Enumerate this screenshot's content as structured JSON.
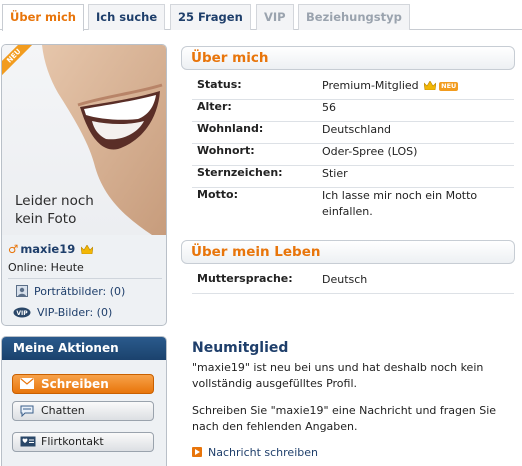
{
  "tabs": [
    {
      "label": "Über mich",
      "state": "active"
    },
    {
      "label": "Ich suche",
      "state": "normal"
    },
    {
      "label": "25 Fragen",
      "state": "normal"
    },
    {
      "label": "VIP",
      "state": "disabled"
    },
    {
      "label": "Beziehungstyp",
      "state": "disabled"
    }
  ],
  "profile": {
    "ribbon": "NEU",
    "no_photo_text_line1": "Leider noch",
    "no_photo_text_line2": "kein Foto",
    "gender_symbol": "♂",
    "username": "maxie19",
    "online": "Online: Heute",
    "links": [
      {
        "label": "Porträtbilder: (0)",
        "icon": "portrait-icon"
      },
      {
        "label": "VIP-Bilder: (0)",
        "icon": "vip-icon"
      }
    ]
  },
  "actions": {
    "title": "Meine Aktionen",
    "buttons": [
      {
        "label": "Schreiben",
        "icon": "envelope-icon"
      },
      {
        "label": "Chatten",
        "icon": "chat-bubble-icon"
      },
      {
        "label": "Flirtkontakt",
        "icon": "flirt-card-icon"
      }
    ]
  },
  "about": {
    "title": "Über mich",
    "rows": [
      {
        "key": "Status:",
        "value": "Premium-Mitglied"
      },
      {
        "key": "Alter:",
        "value": "56"
      },
      {
        "key": "Wohnland:",
        "value": "Deutschland"
      },
      {
        "key": "Wohnort:",
        "value": "Oder-Spree (LOS)"
      },
      {
        "key": "Sternzeichen:",
        "value": "Stier"
      },
      {
        "key": "Motto:",
        "value": "Ich lasse mir noch ein Motto einfallen."
      }
    ],
    "status_badge": "NEU"
  },
  "life": {
    "title": "Über mein Leben",
    "rows": [
      {
        "key": "Muttersprache:",
        "value": "Deutsch"
      }
    ]
  },
  "newmember": {
    "title": "Neumitglied",
    "p1": "\"maxie19\" ist neu bei uns und hat deshalb noch kein vollständig ausgefülltes Profil.",
    "p2": "Schreiben Sie \"maxie19\" eine Nachricht und fragen Sie nach den fehlenden Angaben.",
    "link": "Nachricht schreiben"
  },
  "colors": {
    "accent": "#e8750b",
    "navy": "#1f3f6b",
    "gold": "#f2b705"
  }
}
